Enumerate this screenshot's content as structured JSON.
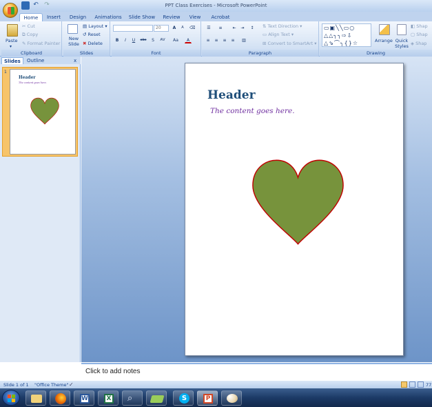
{
  "window": {
    "title": "PPT Class Exercises - Microsoft PowerPoint"
  },
  "tabs": [
    "Home",
    "Insert",
    "Design",
    "Animations",
    "Slide Show",
    "Review",
    "View",
    "Acrobat"
  ],
  "active_tab": "Home",
  "ribbon": {
    "clipboard": {
      "paste": "Paste",
      "cut": "Cut",
      "copy": "Copy",
      "format_painter": "Format Painter",
      "label": "Clipboard"
    },
    "slides": {
      "new_slide": "New Slide",
      "layout": "Layout",
      "reset": "Reset",
      "delete": "Delete",
      "label": "Slides"
    },
    "font": {
      "size": "20",
      "bold": "B",
      "italic": "I",
      "underline": "U",
      "strike": "abc",
      "shadow": "S",
      "spacing": "AV",
      "case": "Aa",
      "color": "A",
      "grow": "A",
      "shrink": "A",
      "label": "Font"
    },
    "paragraph": {
      "text_direction": "Text Direction",
      "align_text": "Align Text",
      "convert_smartart": "Convert to SmartArt",
      "label": "Paragraph"
    },
    "drawing": {
      "arrange": "Arrange",
      "quick_styles": "Quick Styles",
      "shape1": "Shap",
      "shape2": "Shap",
      "shape3": "Shap",
      "label": "Drawing"
    }
  },
  "left_pane": {
    "tab_slides": "Slides",
    "tab_outline": "Outline",
    "close": "x",
    "slide_number": "1",
    "thumb_header": "Header",
    "thumb_content": "The content goes here."
  },
  "slide": {
    "header": "Header",
    "content": "The content goes here."
  },
  "notes": {
    "placeholder": "Click to add notes"
  },
  "status": {
    "slide": "Slide 1 of 1",
    "theme": "\"Office Theme\"",
    "zoom": "77"
  },
  "colors": {
    "header": "#1f4e79",
    "content": "#7030a0",
    "heart_fill": "#77933c",
    "heart_stroke": "#c00000"
  }
}
